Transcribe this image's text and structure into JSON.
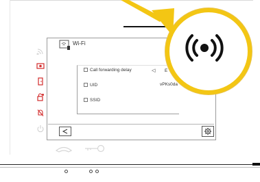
{
  "menu": {
    "header_label": "Wi-Fi",
    "rows": [
      {
        "label": "Call forwarding delay"
      },
      {
        "label": "UID"
      },
      {
        "label": "SSID"
      }
    ],
    "row_arrow": "◁",
    "row_value_partial": "E",
    "uid_value_partial": "vPKs0da"
  },
  "icons": {
    "side": [
      "wifi-signal-icon",
      "camera-icon",
      "door-icon",
      "lock-icon",
      "mute-bell-icon",
      "power-icon"
    ],
    "back": "back-icon",
    "settings": "settings-icon",
    "handset": "handset-icon",
    "key": "key-icon",
    "broadcast": "broadcast-icon"
  },
  "colors": {
    "accent_red": "#d22b2b",
    "highlight_yellow": "#f3c614",
    "light_gray": "#dcdcdc"
  }
}
